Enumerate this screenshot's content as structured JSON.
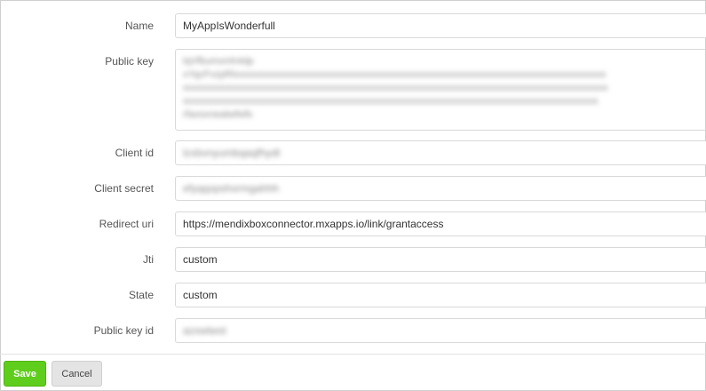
{
  "form": {
    "name": {
      "label": "Name",
      "value": "MyAppIsWonderfull"
    },
    "public_key": {
      "label": "Public key",
      "value_lines": [
        "lqVfbumxmh4dp",
        "xYqcFvzpRtxxxxxxxxxxxxxxxxxxxxxxxxxxxxxxxxxxxxxxxxxxxxxxxxxxxxxxxxxxxxxxxxxxxxxxxxxxxx",
        "xxxxxxxxxxxxxxxxxxxxxxxxxxxxxxxxxxxxxxxxxxxxxxxxxxxxxxxxxxxxxxxxxxxxxxxxxxxxxxxxxxxxxxx",
        "xxxxxxxxxxxxxxxxxxxxxxxxxxxxxxxxxxxxxxxxxxxxxxxxxxxxxxxxxxxxxxxxxxxxxxxxxxxxxxxxxxxxx",
        "rfaxsxneatwfwfs"
      ]
    },
    "client_id": {
      "label": "Client id",
      "value": "lzxbvnyumbqaqfhydt"
    },
    "client_secret": {
      "label": "Client secret",
      "value": "efyqqxpshxrmgahhh"
    },
    "redirect_uri": {
      "label": "Redirect uri",
      "value": "https://mendixboxconnector.mxapps.io/link/grantaccess"
    },
    "jti": {
      "label": "Jti",
      "value": "custom"
    },
    "state": {
      "label": "State",
      "value": "custom"
    },
    "public_key_id": {
      "label": "Public key id",
      "value": "azxwtwst"
    }
  },
  "buttons": {
    "save": "Save",
    "cancel": "Cancel"
  },
  "colors": {
    "save_button": "#5fcd1c",
    "cancel_button": "#e4e4e4",
    "field_border": "#d9d9d9"
  }
}
